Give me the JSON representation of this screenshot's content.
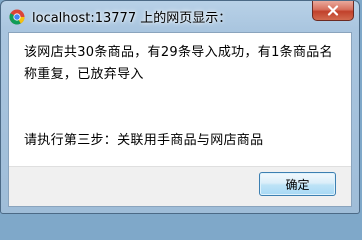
{
  "dialog": {
    "title": "localhost:13777 上的网页显示：",
    "message_line1": "该网店共30条商品，有29条导入成功，有1条商品名称重复，已放弃导入",
    "message_line2": "请执行第三步：关联用手商品与网店商品",
    "ok_label": "确定"
  },
  "icons": {
    "app": "chrome-icon",
    "close": "close-icon"
  },
  "colors": {
    "title_bar": "#a9c5df",
    "close_button": "#c1412b",
    "ok_button_border": "#3c7fb1"
  }
}
